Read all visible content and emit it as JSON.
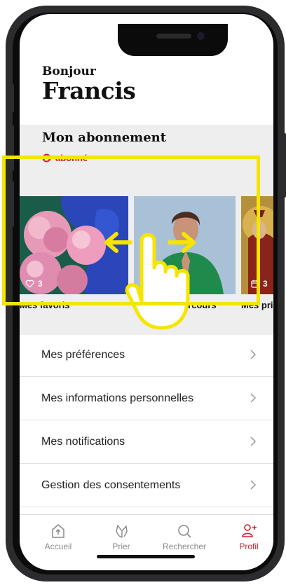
{
  "greeting": {
    "hello": "Bonjour",
    "name": "Francis"
  },
  "subscription": {
    "title": "Mon abonnement",
    "status": "abonné",
    "status_color": "#d0202d"
  },
  "cards": [
    {
      "label": "Mes favoris",
      "count": "3",
      "icon": "heart-icon"
    },
    {
      "label": "parcours",
      "count": "",
      "icon": ""
    },
    {
      "label": "Mes priè",
      "count": "3",
      "icon": "calendar-icon"
    }
  ],
  "menu": [
    {
      "label": "Mes préférences"
    },
    {
      "label": "Mes informations personnelles"
    },
    {
      "label": "Mes notifications"
    },
    {
      "label": "Gestion des consentements"
    }
  ],
  "tabs": [
    {
      "label": "Accueil",
      "icon": "home-icon"
    },
    {
      "label": "Prier",
      "icon": "praying-hands-icon"
    },
    {
      "label": "Rechercher",
      "icon": "search-icon"
    },
    {
      "label": "Profil",
      "icon": "profile-icon",
      "active": true
    }
  ],
  "colors": {
    "accent": "#d0202d",
    "highlight": "#f5e500"
  }
}
